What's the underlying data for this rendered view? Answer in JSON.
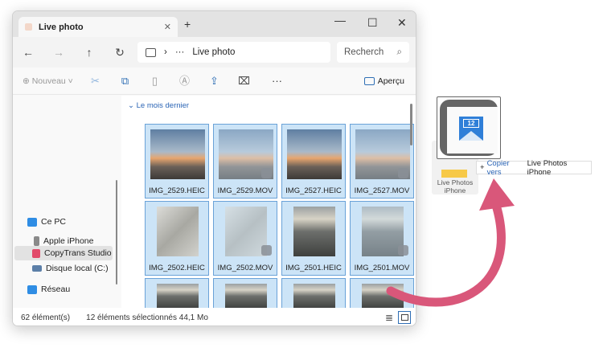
{
  "window": {
    "tab_title": "Live photo",
    "new_tab": "+",
    "minimize": "—",
    "maximize": "☐",
    "close": "✕"
  },
  "nav": {
    "back": "←",
    "forward": "→",
    "up": "↑",
    "refresh": "↻",
    "breadcrumb_sep": "›",
    "breadcrumb_more": "···",
    "path": "Live photo",
    "search_placeholder": "Recherch"
  },
  "toolbar": {
    "new_label": "Nouveau",
    "more": "···",
    "preview_label": "Aperçu"
  },
  "sidebar": {
    "items": [
      {
        "label": "Ce PC",
        "color": "#2f8de4"
      },
      {
        "label": "Apple iPhone",
        "color": "#8a8a8a"
      },
      {
        "label": "CopyTrans Studio",
        "color": "#e24a6a"
      },
      {
        "label": "Disque local (C:)",
        "color": "#5c7fa8"
      },
      {
        "label": "Réseau",
        "color": "#2f8de4"
      }
    ]
  },
  "main": {
    "group_label": "Le mois dernier",
    "files": [
      {
        "name": "IMG_2529.HEIC",
        "kind": "sunset",
        "live": false
      },
      {
        "name": "IMG_2529.MOV",
        "kind": "sunset",
        "live": true
      },
      {
        "name": "IMG_2527.HEIC",
        "kind": "sunset",
        "live": false
      },
      {
        "name": "IMG_2527.MOV",
        "kind": "sunset",
        "live": true
      },
      {
        "name": "IMG_2502.HEIC",
        "kind": "sand",
        "live": false
      },
      {
        "name": "IMG_2502.MOV",
        "kind": "sand",
        "live": true
      },
      {
        "name": "IMG_2501.HEIC",
        "kind": "sea",
        "live": false
      },
      {
        "name": "IMG_2501.MOV",
        "kind": "sea",
        "live": true
      },
      {
        "name": "",
        "kind": "sea",
        "live": false
      },
      {
        "name": "",
        "kind": "sea",
        "live": false
      },
      {
        "name": "",
        "kind": "sea",
        "live": false
      },
      {
        "name": "",
        "kind": "sea",
        "live": false
      }
    ]
  },
  "status": {
    "count": "62 élément(s)",
    "selection": "12 éléments sélectionnés  44,1 Mo"
  },
  "drag": {
    "badge_number": "12",
    "folder_label": "Live Photos iPhone",
    "tooltip_plus": "+",
    "tooltip_action": "Copier vers",
    "tooltip_target": "Live Photos iPhone"
  },
  "colors": {
    "selection": "#cce4f7",
    "accent": "#2a64b5",
    "arrow": "#d9577a"
  }
}
